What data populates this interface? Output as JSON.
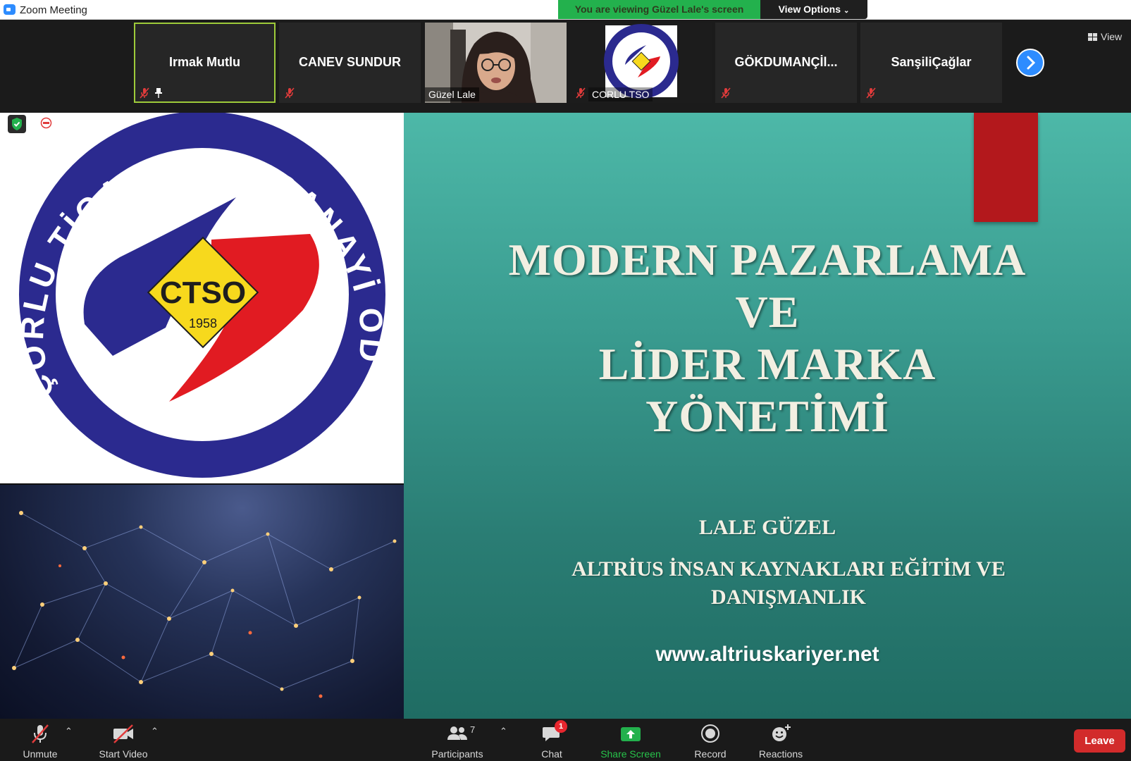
{
  "window": {
    "title": "Zoom Meeting"
  },
  "banner": {
    "viewing_text": "You are viewing Güzel Lale's screen",
    "view_options_label": "View Options"
  },
  "participants": [
    {
      "name": "Irmak Mutlu",
      "muted": true,
      "pinned": true,
      "active": true
    },
    {
      "name": "CANEV SUNDUR",
      "muted": true
    },
    {
      "name": "Güzel Lale",
      "video": true
    },
    {
      "name": "CORLU TSO",
      "muted": true,
      "logo": true
    },
    {
      "name": "GÖKDUMANÇİl...",
      "muted": true
    },
    {
      "name": "SanşiliÇağlar",
      "muted": true
    }
  ],
  "strip": {
    "view_label": "View"
  },
  "logo": {
    "ring_text": "ÇORLU TİCARET ve SANAYİ ODASI",
    "center_text": "CTSO",
    "year": "1958"
  },
  "slide": {
    "title_lines": [
      "MODERN PAZARLAMA",
      "VE",
      "LİDER MARKA",
      "YÖNETİMİ"
    ],
    "author": "LALE GÜZEL",
    "company_lines": [
      "ALTRİUS İNSAN KAYNAKLARI EĞİTİM VE",
      "DANIŞMANLIK"
    ],
    "website": "www.altriuskariyer.net"
  },
  "toolbar": {
    "unmute": "Unmute",
    "start_video": "Start Video",
    "participants": "Participants",
    "participants_count": "7",
    "chat": "Chat",
    "chat_badge": "1",
    "share_screen": "Share Screen",
    "record": "Record",
    "reactions": "Reactions",
    "leave": "Leave"
  },
  "colors": {
    "accent": "#2d8cff",
    "share_green": "#23b14d",
    "leave_red": "#d22b2b",
    "slide_teal": "#3a9c90",
    "logo_blue": "#2b2a8f",
    "logo_red": "#e11b22",
    "logo_yellow": "#f7d91d"
  }
}
